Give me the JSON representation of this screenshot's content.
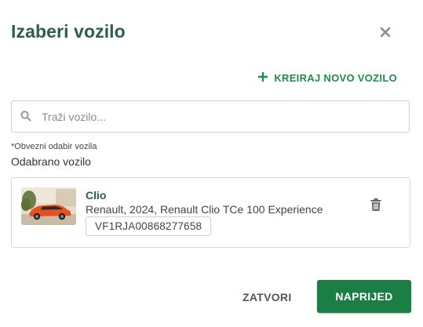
{
  "dialog": {
    "title": "Izaberi vozilo",
    "close_icon": "close-icon"
  },
  "create_vehicle": {
    "icon": "plus-icon",
    "label": "KREIRAJ NOVO VOZILO"
  },
  "search": {
    "icon": "search-icon",
    "placeholder": "Traži vozilo..."
  },
  "required_note": "*Obvezni odabir vozila",
  "selected_label": "Odabrano vozilo",
  "vehicle": {
    "name": "Clio",
    "description": "Renault, 2024, Renault Clio TCe 100 Experience",
    "vin": "VF1RJA00868277658",
    "delete_icon": "trash-icon"
  },
  "footer": {
    "close_label": "ZATVORI",
    "next_label": "NAPRIJED"
  },
  "colors": {
    "title": "#2e5e47",
    "accent": "#1f8a4c",
    "primary_button": "#1b7f45"
  }
}
